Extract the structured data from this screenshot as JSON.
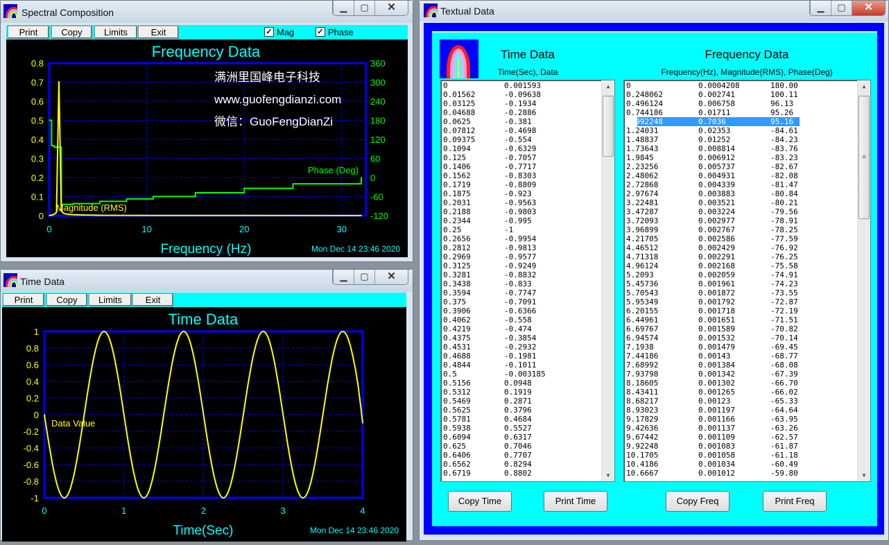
{
  "spectral_window": {
    "title": "Spectral Composition",
    "buttons": [
      "Print",
      "Copy",
      "Limits",
      "Exit"
    ],
    "checkboxes": [
      {
        "label": "Mag",
        "checked": true
      },
      {
        "label": "Phase",
        "checked": true
      }
    ],
    "watermark": [
      "满洲里国峰电子科技",
      "www.guofengdianzi.com",
      "微信：GuoFengDianZi"
    ],
    "timestamp": "Mon Dec 14 23:46 2020"
  },
  "time_window": {
    "title": "Time Data",
    "buttons": [
      "Print",
      "Copy",
      "Limits",
      "Exit"
    ],
    "timestamp": "Mon Dec 14 23:46 2020"
  },
  "textual_window": {
    "title": "Textual Data",
    "time_header": "Time Data",
    "time_sub": "Time(Sec), Data",
    "freq_header": "Frequency Data",
    "freq_sub": "Frequency(Hz), Magnitude(RMS), Phase(Deg)",
    "buttons": {
      "copy_time": "Copy Time",
      "print_time": "Print Time",
      "copy_freq": "Copy Freq",
      "print_freq": "Print Freq"
    },
    "selected_freq_row": 4,
    "time_rows": [
      [
        "0",
        "0.001593"
      ],
      [
        "0.01562",
        "-0.09638"
      ],
      [
        "0.03125",
        "-0.1934"
      ],
      [
        "0.04688",
        "-0.2886"
      ],
      [
        "0.0625",
        "-0.381"
      ],
      [
        "0.07812",
        "-0.4698"
      ],
      [
        "0.09375",
        "-0.554"
      ],
      [
        "0.1094",
        "-0.6329"
      ],
      [
        "0.125",
        "-0.7057"
      ],
      [
        "0.1406",
        "-0.7717"
      ],
      [
        "0.1562",
        "-0.8303"
      ],
      [
        "0.1719",
        "-0.8809"
      ],
      [
        "0.1875",
        "-0.923"
      ],
      [
        "0.2031",
        "-0.9563"
      ],
      [
        "0.2188",
        "-0.9803"
      ],
      [
        "0.2344",
        "-0.995"
      ],
      [
        "0.25",
        "-1"
      ],
      [
        "0.2656",
        "-0.9954"
      ],
      [
        "0.2812",
        "-0.9813"
      ],
      [
        "0.2969",
        "-0.9577"
      ],
      [
        "0.3125",
        "-0.9249"
      ],
      [
        "0.3281",
        "-0.8832"
      ],
      [
        "0.3438",
        "-0.833"
      ],
      [
        "0.3594",
        "-0.7747"
      ],
      [
        "0.375",
        "-0.7091"
      ],
      [
        "0.3906",
        "-0.6366"
      ],
      [
        "0.4062",
        "-0.558"
      ],
      [
        "0.4219",
        "-0.474"
      ],
      [
        "0.4375",
        "-0.3854"
      ],
      [
        "0.4531",
        "-0.2932"
      ],
      [
        "0.4688",
        "-0.1981"
      ],
      [
        "0.4844",
        "-0.1011"
      ],
      [
        "0.5",
        "-0.003185"
      ],
      [
        "0.5156",
        "0.0948"
      ],
      [
        "0.5312",
        "0.1919"
      ],
      [
        "0.5469",
        "0.2871"
      ],
      [
        "0.5625",
        "0.3796"
      ],
      [
        "0.5781",
        "0.4684"
      ],
      [
        "0.5938",
        "0.5527"
      ],
      [
        "0.6094",
        "0.6317"
      ],
      [
        "0.625",
        "0.7046"
      ],
      [
        "0.6406",
        "0.7707"
      ],
      [
        "0.6562",
        "0.8294"
      ],
      [
        "0.6719",
        "0.8802"
      ]
    ],
    "freq_rows": [
      [
        "0",
        "0.0004208",
        "180.00"
      ],
      [
        "0.248062",
        "0.002741",
        "100.11"
      ],
      [
        "0.496124",
        "0.006758",
        "96.13"
      ],
      [
        "0.744186",
        "0.01711",
        "95.26"
      ],
      [
        "0.992248",
        "0.7036",
        "95.16"
      ],
      [
        "1.24031",
        "0.02353",
        "-84.61"
      ],
      [
        "1.48837",
        "0.01252",
        "-84.23"
      ],
      [
        "1.73643",
        "0.008814",
        "-83.76"
      ],
      [
        "1.9845",
        "0.006912",
        "-83.23"
      ],
      [
        "2.23256",
        "0.005737",
        "-82.67"
      ],
      [
        "2.48062",
        "0.004931",
        "-82.08"
      ],
      [
        "2.72868",
        "0.004339",
        "-81.47"
      ],
      [
        "2.97674",
        "0.003883",
        "-80.84"
      ],
      [
        "3.22481",
        "0.003521",
        "-80.21"
      ],
      [
        "3.47287",
        "0.003224",
        "-79.56"
      ],
      [
        "3.72093",
        "0.002977",
        "-78.91"
      ],
      [
        "3.96899",
        "0.002767",
        "-78.25"
      ],
      [
        "4.21705",
        "0.002586",
        "-77.59"
      ],
      [
        "4.46512",
        "0.002429",
        "-76.92"
      ],
      [
        "4.71318",
        "0.002291",
        "-76.25"
      ],
      [
        "4.96124",
        "0.002168",
        "-75.58"
      ],
      [
        "5.2093",
        "0.002059",
        "-74.91"
      ],
      [
        "5.45736",
        "0.001961",
        "-74.23"
      ],
      [
        "5.70543",
        "0.001872",
        "-73.55"
      ],
      [
        "5.95349",
        "0.001792",
        "-72.87"
      ],
      [
        "6.20155",
        "0.001718",
        "-72.19"
      ],
      [
        "6.44961",
        "0.001651",
        "-71.51"
      ],
      [
        "6.69767",
        "0.001589",
        "-70.82"
      ],
      [
        "6.94574",
        "0.001532",
        "-70.14"
      ],
      [
        "7.1938",
        "0.001479",
        "-69.45"
      ],
      [
        "7.44186",
        "0.00143",
        "-68.77"
      ],
      [
        "7.68992",
        "0.001384",
        "-68.08"
      ],
      [
        "7.93798",
        "0.001342",
        "-67.39"
      ],
      [
        "8.18605",
        "0.001302",
        "-66.70"
      ],
      [
        "8.43411",
        "0.001265",
        "-66.02"
      ],
      [
        "8.68217",
        "0.00123",
        "-65.33"
      ],
      [
        "8.93023",
        "0.001197",
        "-64.64"
      ],
      [
        "9.17829",
        "0.001166",
        "-63.95"
      ],
      [
        "9.42636",
        "0.001137",
        "-63.26"
      ],
      [
        "9.67442",
        "0.001109",
        "-62.57"
      ],
      [
        "9.92248",
        "0.001083",
        "-61.87"
      ],
      [
        "10.1705",
        "0.001058",
        "-61.18"
      ],
      [
        "10.4186",
        "0.001034",
        "-60.49"
      ],
      [
        "10.6667",
        "0.001012",
        "-59.80"
      ]
    ]
  },
  "chart_data": [
    {
      "type": "line",
      "title": "Frequency Data",
      "xlabel": "Frequency (Hz)",
      "xlim": [
        0,
        32.5
      ],
      "xticks": [
        "0",
        "10",
        "20",
        "30"
      ],
      "ylim_left": [
        0,
        0.8
      ],
      "yticks_left": [
        "0.8",
        "0.7",
        "0.6",
        "0.5",
        "0.4",
        "0.3",
        "0.2",
        "0.1",
        "0"
      ],
      "ylim_right": [
        -120,
        360
      ],
      "yticks_right": [
        "360",
        "300",
        "240",
        "180",
        "120",
        "60",
        "0",
        "-60",
        "-120"
      ],
      "grid": true,
      "colors": {
        "magnitude": "#ffff00",
        "phase": "#00ff00",
        "axes": "#0000ff",
        "title": "#00ffff"
      },
      "series": [
        {
          "name": "Magnitude (RMS)",
          "axis": "left",
          "x": [
            0,
            0.248,
            0.496,
            0.744,
            0.992,
            1.24,
            1.488,
            1.736,
            1.985,
            2.5,
            3,
            5,
            10,
            20,
            32
          ],
          "y": [
            0.0004,
            0.0027,
            0.0068,
            0.0171,
            0.7036,
            0.0235,
            0.0125,
            0.0088,
            0.0069,
            0.0049,
            0.0039,
            0.002,
            0.001,
            0.0008,
            0.0006
          ]
        },
        {
          "name": "Phase (Deg)",
          "axis": "right",
          "x": [
            0,
            0.248,
            0.496,
            0.744,
            0.992,
            1.24,
            2.48,
            5.2,
            7.94,
            10.67,
            15,
            20,
            25,
            32
          ],
          "y": [
            180,
            100.11,
            96.13,
            95.26,
            95.16,
            -84.61,
            -82.08,
            -74.91,
            -67.39,
            -59.8,
            -48,
            -34,
            -20,
            0
          ]
        }
      ]
    },
    {
      "type": "line",
      "title": "Time Data",
      "xlabel": "Time(Sec)",
      "xlim": [
        0,
        4
      ],
      "xticks": [
        "0",
        "1",
        "2",
        "3",
        "4"
      ],
      "ylim": [
        -1,
        1
      ],
      "yticks": [
        "1",
        "0.8",
        "0.6",
        "0.4",
        "0.2",
        "0",
        "-0.2",
        "-0.4",
        "-0.6",
        "-0.8",
        "-1"
      ],
      "grid": true,
      "colors": {
        "line": "#ffff00",
        "axes": "#0000ff",
        "title": "#00ffff"
      },
      "series": [
        {
          "name": "Data Value",
          "x": [
            0,
            0.0625,
            0.125,
            0.1875,
            0.25,
            0.3125,
            0.375,
            0.4375,
            0.5,
            0.5625,
            0.625,
            0.6875,
            0.75,
            0.8125,
            0.875,
            0.9375,
            1,
            1.0625,
            1.125,
            1.1875,
            1.25,
            1.3125,
            1.375,
            1.4375,
            1.5,
            1.5625,
            1.625,
            1.6875,
            1.75,
            1.8125,
            1.875,
            1.9375,
            2,
            2.0625,
            2.125,
            2.1875,
            2.25,
            2.3125,
            2.375,
            2.4375,
            2.5,
            2.5625,
            2.625,
            2.6875,
            2.75,
            2.8125,
            2.875,
            2.9375,
            3,
            3.0625,
            3.125,
            3.1875,
            3.25,
            3.3125,
            3.375,
            3.4375,
            3.5,
            3.5625,
            3.625,
            3.6875,
            3.75,
            3.8125,
            3.875,
            3.9375,
            4
          ],
          "y": [
            0,
            -0.381,
            -0.7057,
            -0.923,
            -1,
            -0.9249,
            -0.7091,
            -0.3854,
            -0.003,
            0.3796,
            0.7046,
            0.9239,
            1,
            0.9239,
            0.7071,
            0.3827,
            0,
            -0.3827,
            -0.7071,
            -0.9239,
            -1,
            -0.9239,
            -0.7071,
            -0.3827,
            0,
            0.3827,
            0.7071,
            0.9239,
            1,
            0.9239,
            0.7071,
            0.3827,
            0,
            -0.3827,
            -0.7071,
            -0.9239,
            -1,
            -0.9239,
            -0.7071,
            -0.3827,
            0,
            0.3827,
            0.7071,
            0.9239,
            1,
            0.9239,
            0.7071,
            0.3827,
            0,
            -0.3827,
            -0.7071,
            -0.9239,
            -1,
            -0.9239,
            -0.7071,
            -0.3827,
            0,
            0.3827,
            0.7071,
            0.9239,
            1,
            0.9239,
            0.7071,
            0.3827,
            -0.1
          ]
        }
      ]
    }
  ]
}
